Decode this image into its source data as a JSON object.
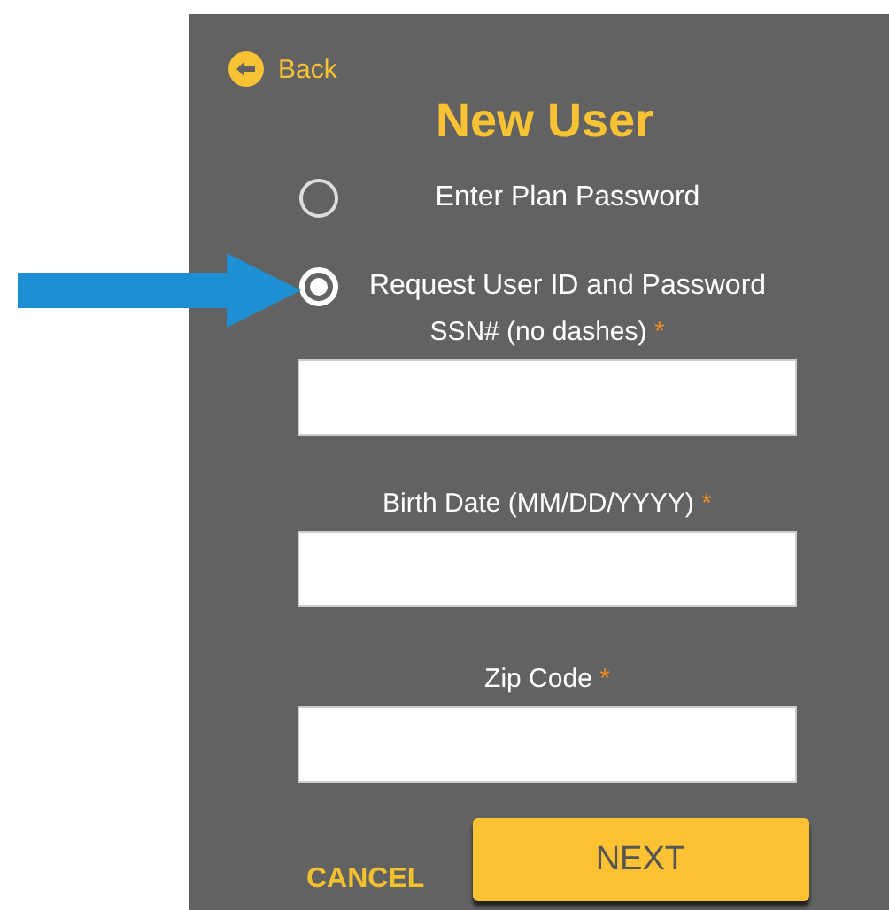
{
  "back_link": {
    "label": "Back"
  },
  "title": "New User",
  "options": [
    {
      "label": "Enter Plan Password",
      "selected": false
    },
    {
      "label": "Request User ID and Password",
      "selected": true
    }
  ],
  "fields": [
    {
      "label": "SSN# (no dashes)",
      "required_mark": "*"
    },
    {
      "label": "Birth Date (MM/DD/YYYY)",
      "required_mark": "*"
    },
    {
      "label": "Zip Code",
      "required_mark": "*"
    }
  ],
  "buttons": {
    "cancel": "CANCEL",
    "next": "NEXT"
  }
}
